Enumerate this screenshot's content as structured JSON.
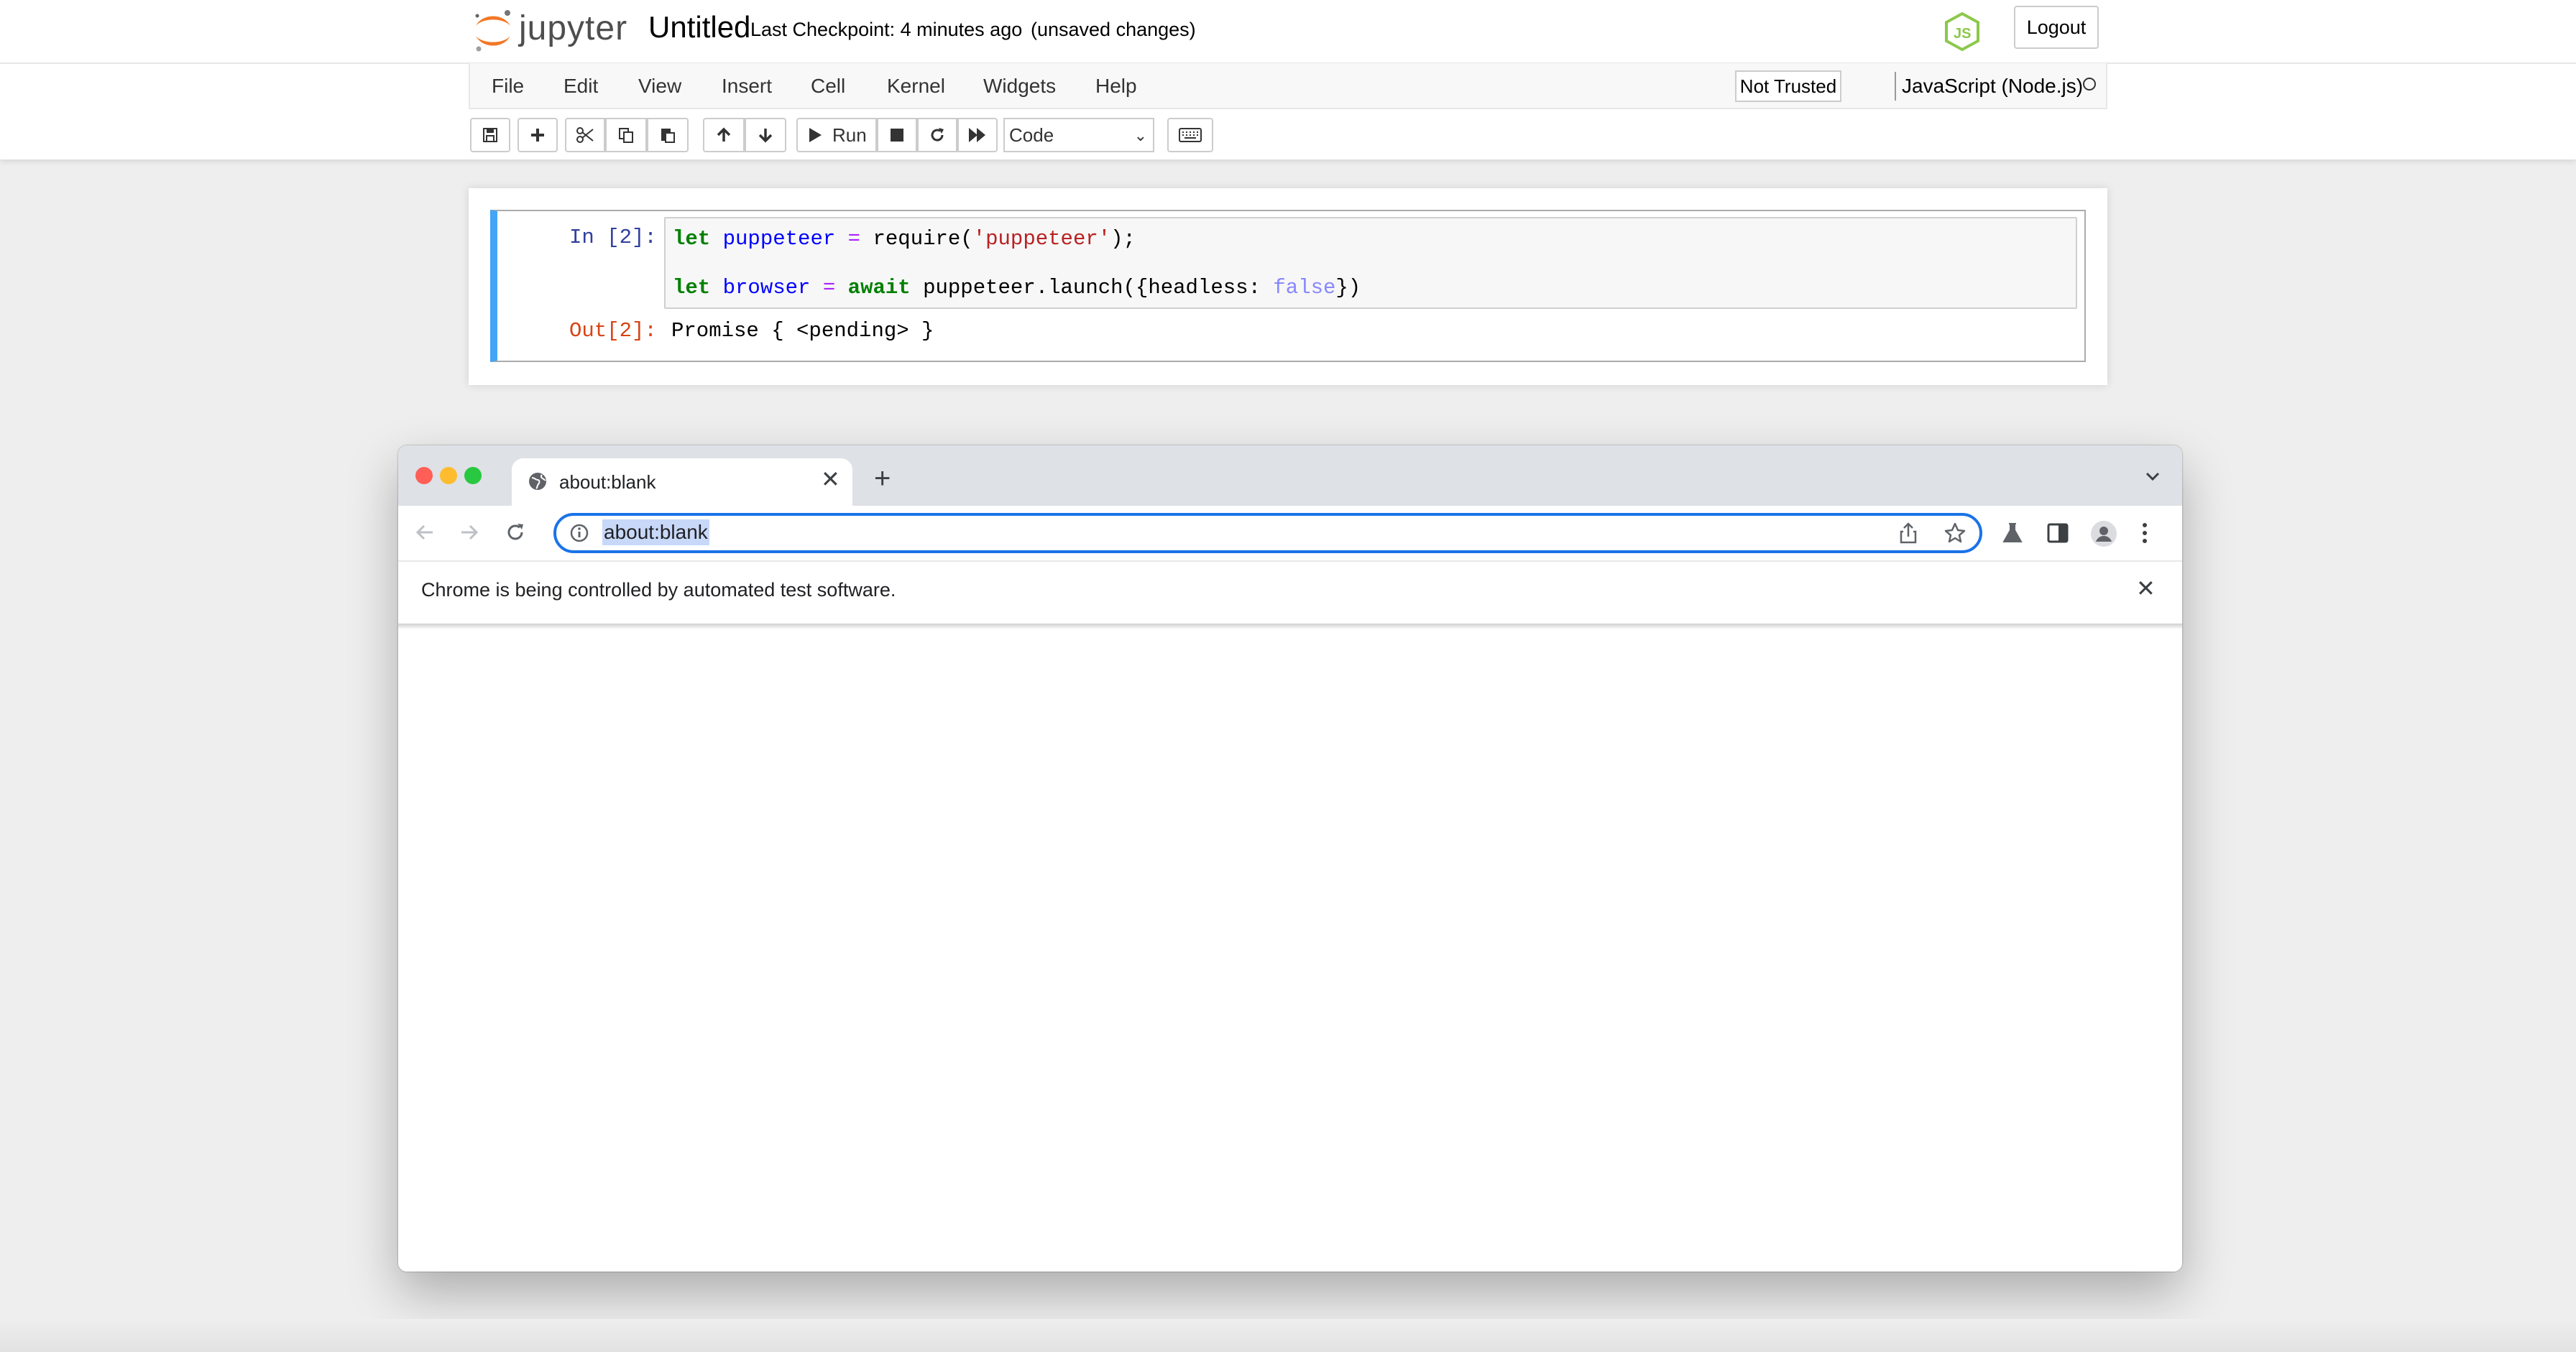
{
  "jupyter": {
    "logo_text": "jupyter",
    "notebook_name": "Untitled",
    "checkpoint": "Last Checkpoint: 4 minutes ago",
    "unsaved": "(unsaved changes)",
    "logout_label": "Logout",
    "menu": [
      "File",
      "Edit",
      "View",
      "Insert",
      "Cell",
      "Kernel",
      "Widgets",
      "Help"
    ],
    "trust_label": "Not Trusted",
    "kernel_name": "JavaScript (Node.js)",
    "toolbar": {
      "run_label": "Run",
      "cell_type": "Code",
      "icons": [
        "save-icon",
        "plus-icon",
        "cut-icon",
        "copy-icon",
        "paste-icon",
        "arrow-up-icon",
        "arrow-down-icon",
        "run-icon",
        "stop-icon",
        "restart-icon",
        "fast-forward-icon",
        "keyboard-icon"
      ]
    },
    "cell": {
      "in_prompt": "In [2]:",
      "out_prompt": "Out[2]:",
      "code_line1": {
        "kw": "let",
        "var": "puppeteer",
        "op": "=",
        "call": "require(",
        "str": "'puppeteer'",
        "end": ");"
      },
      "code_line2": {
        "kw": "let",
        "var": "browser",
        "op": "=",
        "kw2": "await",
        "call": "puppeteer.launch({headless:",
        "atom": "false",
        "end": "})"
      },
      "output": "Promise { <pending> }"
    }
  },
  "chrome": {
    "tab_title": "about:blank",
    "url": "about:blank",
    "infobar_text": "Chrome is being controlled by automated test software.",
    "colors": {
      "close": "#ff5f57",
      "minimize": "#febc2e",
      "zoom": "#28c840",
      "accent": "#1a73e8"
    }
  }
}
